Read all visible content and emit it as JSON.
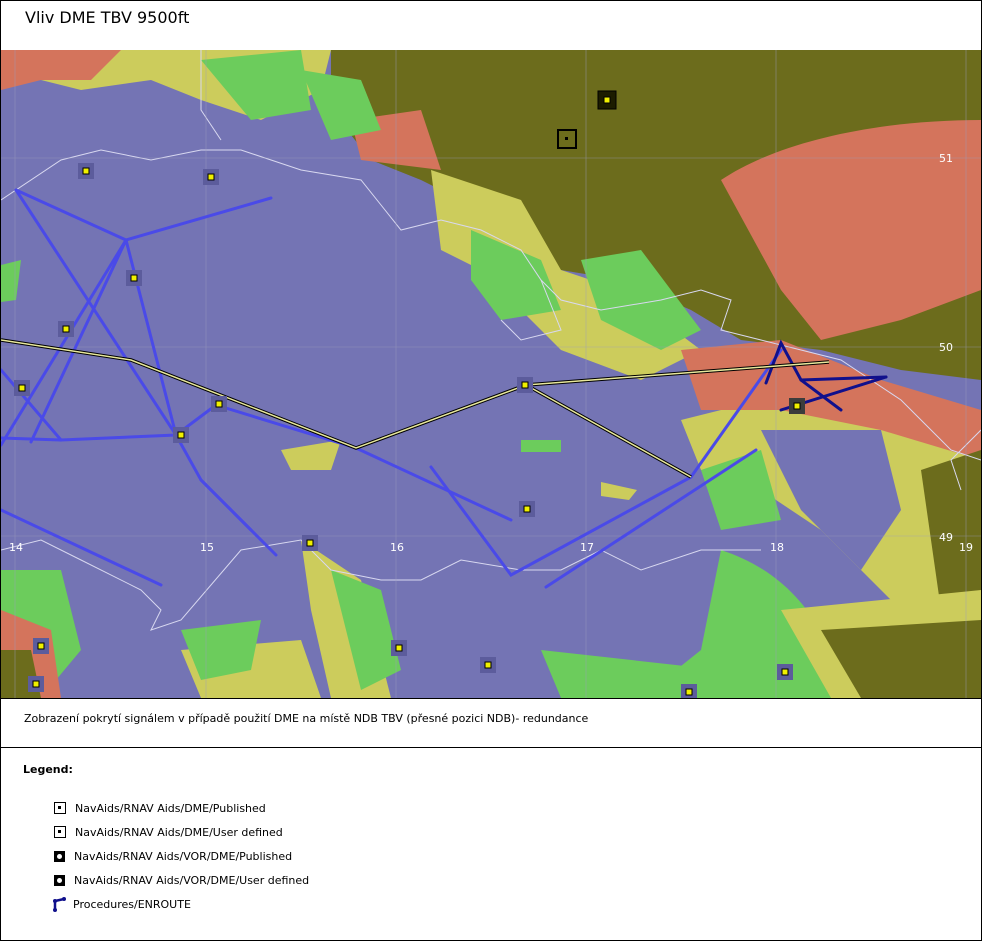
{
  "title": "Vliv DME TBV 9500ft",
  "caption": "Zobrazení pokrytí signálem v případě použití DME na místě NDB TBV (přesné pozici NDB)- redundance",
  "map": {
    "longitude_labels": [
      "14",
      "15",
      "16",
      "17",
      "18",
      "19"
    ],
    "latitude_labels": [
      "51",
      "50",
      "49"
    ],
    "colors": {
      "coverage_blue": "#7474b4",
      "coverage_green": "#6ccc5c",
      "coverage_yellow": "#cccc5c",
      "coverage_red": "#d4745c",
      "no_coverage_olive": "#6c6c1c",
      "route": "#4a4ae8",
      "airway": "#d4d48c",
      "border": "#d8d8f0"
    }
  },
  "legend": {
    "heading": "Legend:",
    "items": [
      {
        "icon": "dme-published-icon",
        "label": "NavAids/RNAV Aids/DME/Published"
      },
      {
        "icon": "dme-user-defined-icon",
        "label": "NavAids/RNAV Aids/DME/User defined"
      },
      {
        "icon": "vor-dme-published-icon",
        "label": "NavAids/RNAV Aids/VOR/DME/Published"
      },
      {
        "icon": "vor-dme-user-defined-icon",
        "label": "NavAids/RNAV Aids/VOR/DME/User defined"
      },
      {
        "icon": "enroute-procedure-icon",
        "label": "Procedures/ENROUTE"
      }
    ]
  }
}
